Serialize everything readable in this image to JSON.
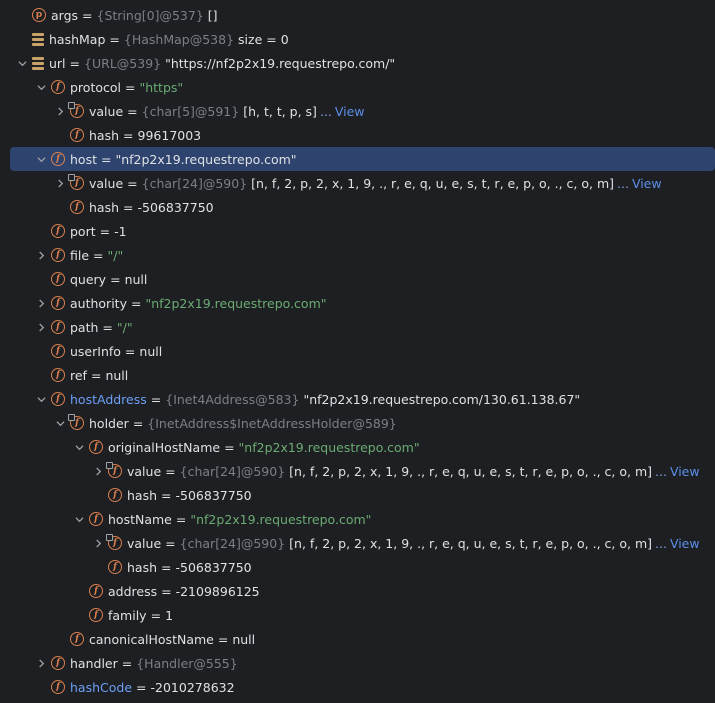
{
  "tree": [
    {
      "id": "args",
      "depth": 0,
      "expand": "none",
      "icon": "p",
      "name": "args",
      "name_hl": false,
      "type": "{String[0]@537}",
      "value": "[]",
      "value_kind": "plain"
    },
    {
      "id": "hashMap",
      "depth": 0,
      "expand": "none",
      "icon": "stack",
      "name": "hashMap",
      "name_hl": false,
      "type": "{HashMap@538}",
      "value": "size = 0",
      "value_kind": "plain"
    },
    {
      "id": "url",
      "depth": 0,
      "expand": "open",
      "icon": "stack",
      "name": "url",
      "name_hl": false,
      "type": "{URL@539}",
      "value": "\"https://nf2p2x19.requestrepo.com/\"",
      "value_kind": "plain"
    },
    {
      "id": "protocol",
      "depth": 1,
      "expand": "open",
      "icon": "f",
      "name": "protocol",
      "name_hl": false,
      "type": "",
      "value": "\"https\"",
      "value_kind": "str"
    },
    {
      "id": "protocol-value",
      "depth": 2,
      "expand": "closed",
      "icon": "f-locked",
      "name": "value",
      "name_hl": false,
      "type": "{char[5]@591}",
      "value": "[h, t, t, p, s]",
      "value_kind": "plain",
      "view": "View"
    },
    {
      "id": "protocol-hash",
      "depth": 2,
      "expand": "none",
      "icon": "f",
      "name": "hash",
      "name_hl": false,
      "type": "",
      "value": "99617003",
      "value_kind": "plain"
    },
    {
      "id": "host",
      "depth": 1,
      "expand": "open",
      "icon": "f",
      "name": "host",
      "name_hl": false,
      "type": "",
      "value": "\"nf2p2x19.requestrepo.com\"",
      "value_kind": "plain",
      "selected": true
    },
    {
      "id": "host-value",
      "depth": 2,
      "expand": "closed",
      "icon": "f-locked",
      "name": "value",
      "name_hl": false,
      "type": "{char[24]@590}",
      "value": "[n, f, 2, p, 2, x, 1, 9, ., r, e, q, u, e, s, t, r, e, p, o, ., c, o, m]",
      "value_kind": "plain",
      "view": "View"
    },
    {
      "id": "host-hash",
      "depth": 2,
      "expand": "none",
      "icon": "f",
      "name": "hash",
      "name_hl": false,
      "type": "",
      "value": "-506837750",
      "value_kind": "plain"
    },
    {
      "id": "port",
      "depth": 1,
      "expand": "none",
      "icon": "f",
      "name": "port",
      "name_hl": false,
      "type": "",
      "value": "-1",
      "value_kind": "plain"
    },
    {
      "id": "file",
      "depth": 1,
      "expand": "closed",
      "icon": "f",
      "name": "file",
      "name_hl": false,
      "type": "",
      "value": "\"/\"",
      "value_kind": "str"
    },
    {
      "id": "query",
      "depth": 1,
      "expand": "none",
      "icon": "f",
      "name": "query",
      "name_hl": false,
      "type": "",
      "value": "null",
      "value_kind": "plain"
    },
    {
      "id": "authority",
      "depth": 1,
      "expand": "closed",
      "icon": "f",
      "name": "authority",
      "name_hl": false,
      "type": "",
      "value": "\"nf2p2x19.requestrepo.com\"",
      "value_kind": "str"
    },
    {
      "id": "path",
      "depth": 1,
      "expand": "closed",
      "icon": "f",
      "name": "path",
      "name_hl": false,
      "type": "",
      "value": "\"/\"",
      "value_kind": "str"
    },
    {
      "id": "userInfo",
      "depth": 1,
      "expand": "none",
      "icon": "f",
      "name": "userInfo",
      "name_hl": false,
      "type": "",
      "value": "null",
      "value_kind": "plain"
    },
    {
      "id": "ref",
      "depth": 1,
      "expand": "none",
      "icon": "f",
      "name": "ref",
      "name_hl": false,
      "type": "",
      "value": "null",
      "value_kind": "plain"
    },
    {
      "id": "hostAddress",
      "depth": 1,
      "expand": "open",
      "icon": "f",
      "name": "hostAddress",
      "name_hl": true,
      "type": "{Inet4Address@583}",
      "value": "\"nf2p2x19.requestrepo.com/130.61.138.67\"",
      "value_kind": "plain"
    },
    {
      "id": "holder",
      "depth": 2,
      "expand": "open",
      "icon": "f-locked",
      "name": "holder",
      "name_hl": false,
      "type": "{InetAddress$InetAddressHolder@589}",
      "value": "",
      "value_kind": "plain"
    },
    {
      "id": "originalHostName",
      "depth": 3,
      "expand": "open",
      "icon": "f",
      "name": "originalHostName",
      "name_hl": false,
      "type": "",
      "value": "\"nf2p2x19.requestrepo.com\"",
      "value_kind": "str"
    },
    {
      "id": "ohn-value",
      "depth": 4,
      "expand": "closed",
      "icon": "f-locked",
      "name": "value",
      "name_hl": false,
      "type": "{char[24]@590}",
      "value": "[n, f, 2, p, 2, x, 1, 9, ., r, e, q, u, e, s, t, r, e, p, o, ., c, o, m]",
      "value_kind": "plain",
      "view": "View"
    },
    {
      "id": "ohn-hash",
      "depth": 4,
      "expand": "none",
      "icon": "f",
      "name": "hash",
      "name_hl": false,
      "type": "",
      "value": "-506837750",
      "value_kind": "plain"
    },
    {
      "id": "hostName",
      "depth": 3,
      "expand": "open",
      "icon": "f",
      "name": "hostName",
      "name_hl": false,
      "type": "",
      "value": "\"nf2p2x19.requestrepo.com\"",
      "value_kind": "str"
    },
    {
      "id": "hn-value",
      "depth": 4,
      "expand": "closed",
      "icon": "f-locked",
      "name": "value",
      "name_hl": false,
      "type": "{char[24]@590}",
      "value": "[n, f, 2, p, 2, x, 1, 9, ., r, e, q, u, e, s, t, r, e, p, o, ., c, o, m]",
      "value_kind": "plain",
      "view": "View"
    },
    {
      "id": "hn-hash",
      "depth": 4,
      "expand": "none",
      "icon": "f",
      "name": "hash",
      "name_hl": false,
      "type": "",
      "value": "-506837750",
      "value_kind": "plain"
    },
    {
      "id": "address",
      "depth": 3,
      "expand": "none",
      "icon": "f",
      "name": "address",
      "name_hl": false,
      "type": "",
      "value": "-2109896125",
      "value_kind": "plain"
    },
    {
      "id": "family",
      "depth": 3,
      "expand": "none",
      "icon": "f",
      "name": "family",
      "name_hl": false,
      "type": "",
      "value": "1",
      "value_kind": "plain"
    },
    {
      "id": "canonicalHostName",
      "depth": 2,
      "expand": "none",
      "icon": "f",
      "name": "canonicalHostName",
      "name_hl": false,
      "type": "",
      "value": "null",
      "value_kind": "plain"
    },
    {
      "id": "handler",
      "depth": 1,
      "expand": "closed",
      "icon": "f",
      "name": "handler",
      "name_hl": false,
      "type": "{Handler@555}",
      "value": "",
      "value_kind": "plain"
    },
    {
      "id": "hashCode",
      "depth": 1,
      "expand": "none",
      "icon": "f",
      "name": "hashCode",
      "name_hl": true,
      "type": "",
      "value": "-2010278632",
      "value_kind": "plain"
    }
  ],
  "labels": {
    "eq": "=",
    "ellipsis": "..."
  },
  "colors": {
    "background": "#1e1f22",
    "selected": "#2e436e",
    "string": "#6aab73",
    "type": "#7c7f85",
    "field_icon": "#d9804e",
    "link": "#5c8fe8"
  }
}
